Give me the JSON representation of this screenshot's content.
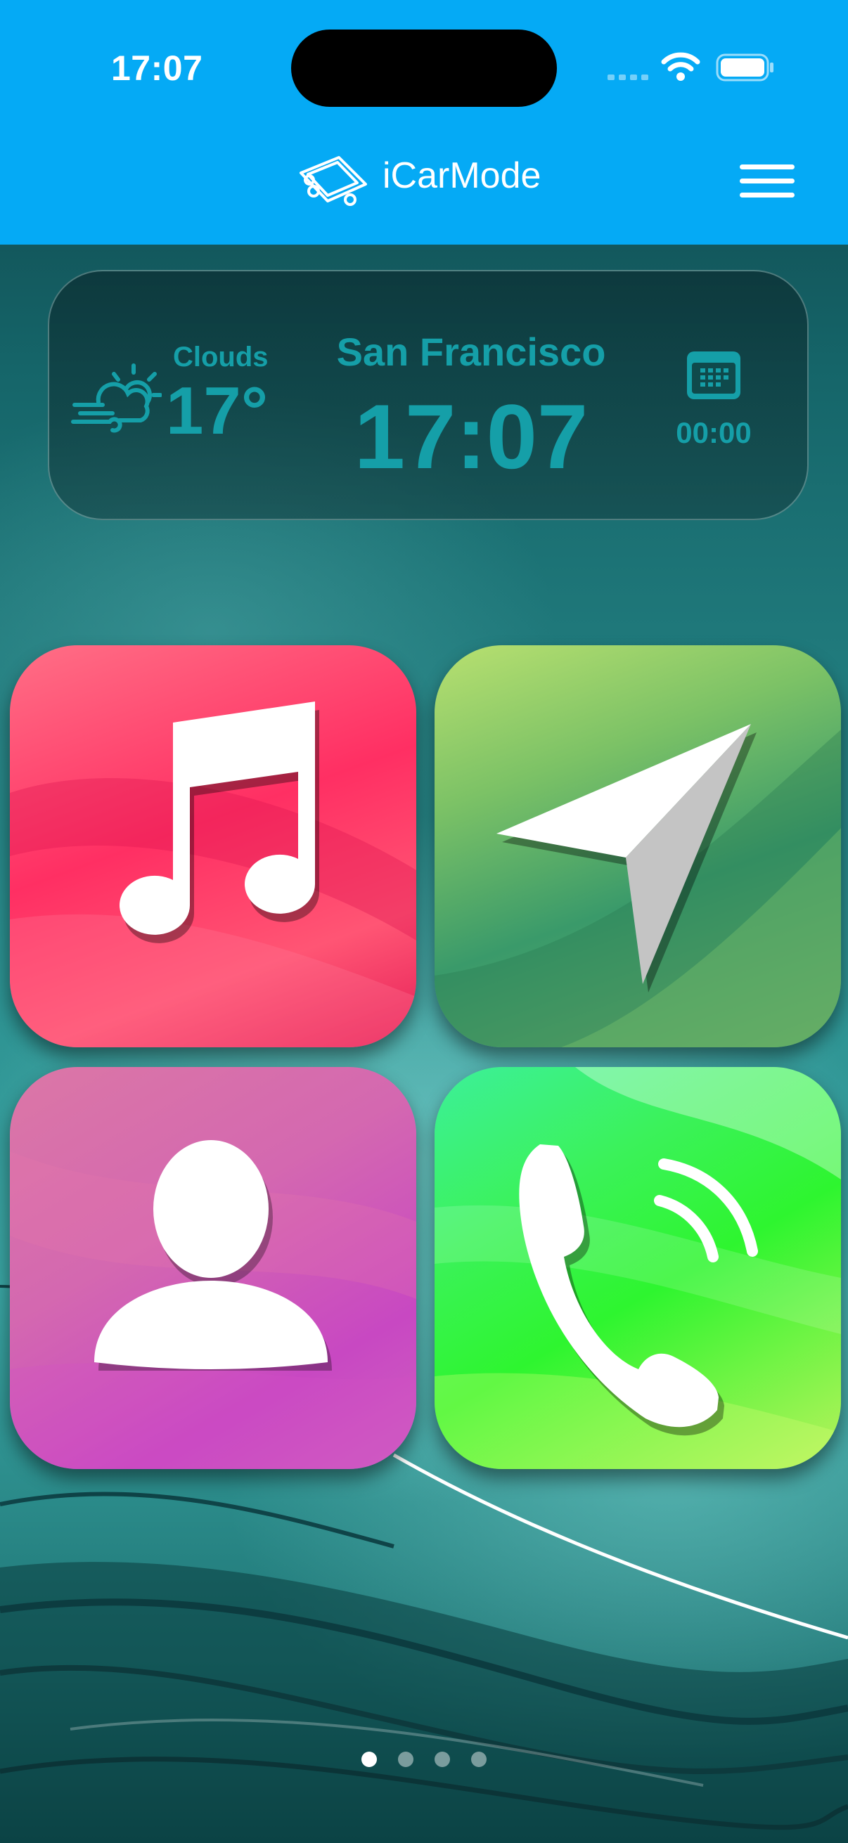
{
  "status_bar": {
    "time": "17:07",
    "background_color": "#05aaf5"
  },
  "nav": {
    "title": "iCarMode",
    "logo_icon": "car-phone-logo-icon",
    "menu_icon": "hamburger-menu-icon"
  },
  "widget": {
    "weather_condition": "Clouds",
    "temperature": "17°",
    "city": "San Francisco",
    "clock": "17:07",
    "timer": "00:00",
    "weather_icon": "wind-cloud-sun-icon",
    "calendar_icon": "calendar-icon",
    "text_color": "#159fa8"
  },
  "tiles": [
    {
      "name": "music",
      "icon": "music-note-icon",
      "color": "#ff3566"
    },
    {
      "name": "navigation",
      "icon": "navigation-arrow-icon",
      "color": "#5aaa68"
    },
    {
      "name": "contacts",
      "icon": "person-icon",
      "color": "#cf58bb"
    },
    {
      "name": "phone",
      "icon": "phone-call-icon",
      "color": "#36f240"
    }
  ],
  "pager": {
    "page_count": 4,
    "current_page": 1
  }
}
